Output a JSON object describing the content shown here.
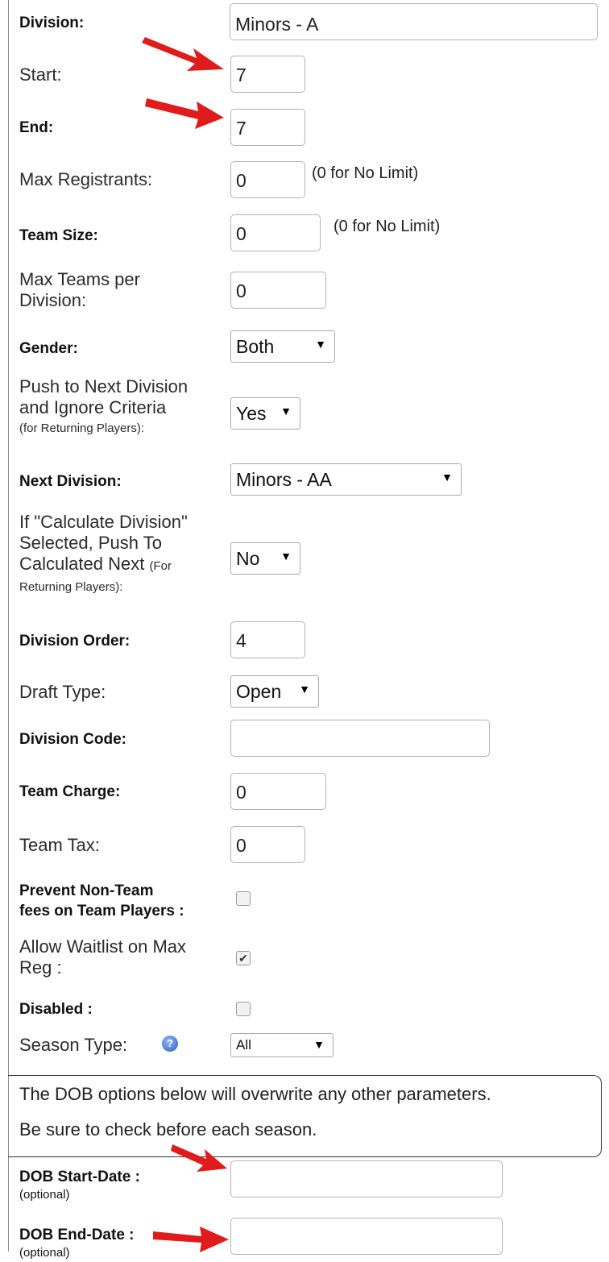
{
  "fields": {
    "division": {
      "label": "Division:",
      "value": "Minors - A"
    },
    "start": {
      "label": "Start:",
      "value": "7"
    },
    "end": {
      "label": "End:",
      "value": "7"
    },
    "max_registrants": {
      "label": "Max Registrants:",
      "value": "0",
      "note": "(0 for No Limit)"
    },
    "team_size": {
      "label": "Team Size:",
      "value": "0",
      "note": "(0 for No Limit)"
    },
    "max_teams": {
      "label_line1": "Max Teams per",
      "label_line2": "Division:",
      "value": "0"
    },
    "gender": {
      "label": "Gender:",
      "value": "Both"
    },
    "push_next": {
      "label_line1": "Push to Next Division",
      "label_line2": "and Ignore Criteria",
      "label_small": "(for Returning Players):",
      "value": "Yes"
    },
    "next_division": {
      "label": "Next Division:",
      "value": "Minors - AA"
    },
    "calc_division": {
      "label_line1": "If \"Calculate Division\"",
      "label_line2": "Selected, Push To",
      "label_line3": "Calculated Next",
      "label_small1": "(For",
      "label_small2": "Returning Players):",
      "value": "No"
    },
    "division_order": {
      "label": "Division Order:",
      "value": "4"
    },
    "draft_type": {
      "label": "Draft Type:",
      "value": "Open"
    },
    "division_code": {
      "label": "Division Code:",
      "value": ""
    },
    "team_charge": {
      "label": "Team Charge:",
      "value": "0"
    },
    "team_tax": {
      "label": "Team Tax:",
      "value": "0"
    },
    "prevent_fees": {
      "label_line1": "Prevent Non-Team",
      "label_line2": "fees on Team Players :",
      "checked": false
    },
    "allow_waitlist": {
      "label_line1": "Allow Waitlist on Max",
      "label_line2": "Reg :",
      "checked": true
    },
    "disabled": {
      "label": "Disabled :",
      "checked": false
    },
    "season_type": {
      "label": "Season Type:",
      "value": "All"
    },
    "dob_notice": {
      "line1": "The DOB options below will overwrite any other parameters.",
      "line2": "Be sure to check before each season."
    },
    "dob_start": {
      "label": "DOB Start-Date :",
      "sub": "(optional)",
      "value": ""
    },
    "dob_end": {
      "label": "DOB End-Date :",
      "sub": "(optional)",
      "value": ""
    }
  },
  "icons": {
    "dropdown": "chevron-down-icon",
    "help": "question-circle-icon",
    "checkmark": "checkmark-icon",
    "annotation": "red-arrow-icon"
  },
  "colors": {
    "annotation_arrow": "#e01b1b",
    "help_icon": "#2f62c4"
  }
}
